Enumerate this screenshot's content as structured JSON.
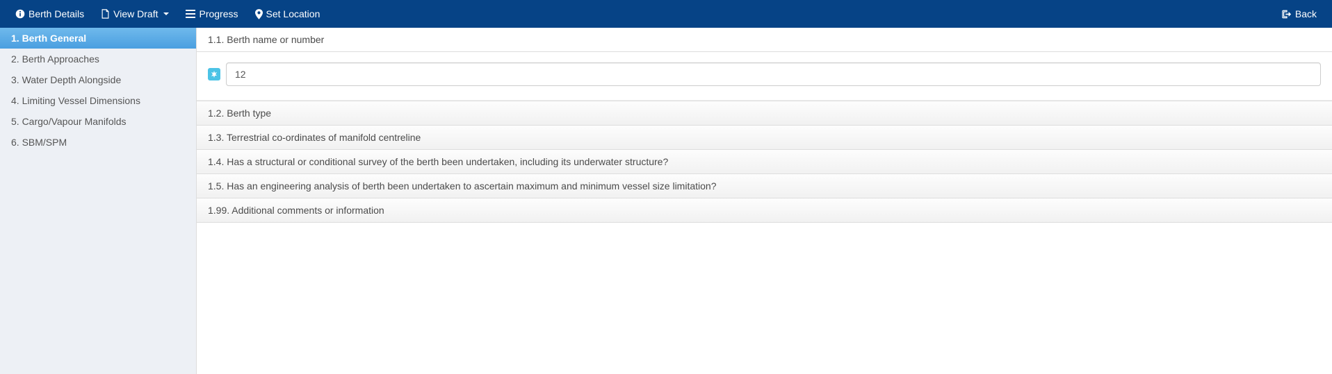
{
  "topnav": {
    "berth_details": "Berth Details",
    "view_draft": "View Draft",
    "progress": "Progress",
    "set_location": "Set Location",
    "back": "Back"
  },
  "sidebar": {
    "items": [
      {
        "label": "1. Berth General"
      },
      {
        "label": "2. Berth Approaches"
      },
      {
        "label": "3. Water Depth Alongside"
      },
      {
        "label": "4. Limiting Vessel Dimensions"
      },
      {
        "label": "5. Cargo/Vapour Manifolds"
      },
      {
        "label": "6. SBM/SPM"
      }
    ]
  },
  "panels": [
    {
      "title": "1.1. Berth name or number"
    },
    {
      "title": "1.2. Berth type"
    },
    {
      "title": "1.3. Terrestrial co-ordinates of manifold centreline"
    },
    {
      "title": "1.4. Has a structural or conditional survey of the berth been undertaken, including its underwater structure?"
    },
    {
      "title": "1.5. Has an engineering analysis of berth been undertaken to ascertain maximum and minimum vessel size limitation?"
    },
    {
      "title": "1.99. Additional comments or information"
    }
  ],
  "form": {
    "berth_name_value": "12"
  }
}
